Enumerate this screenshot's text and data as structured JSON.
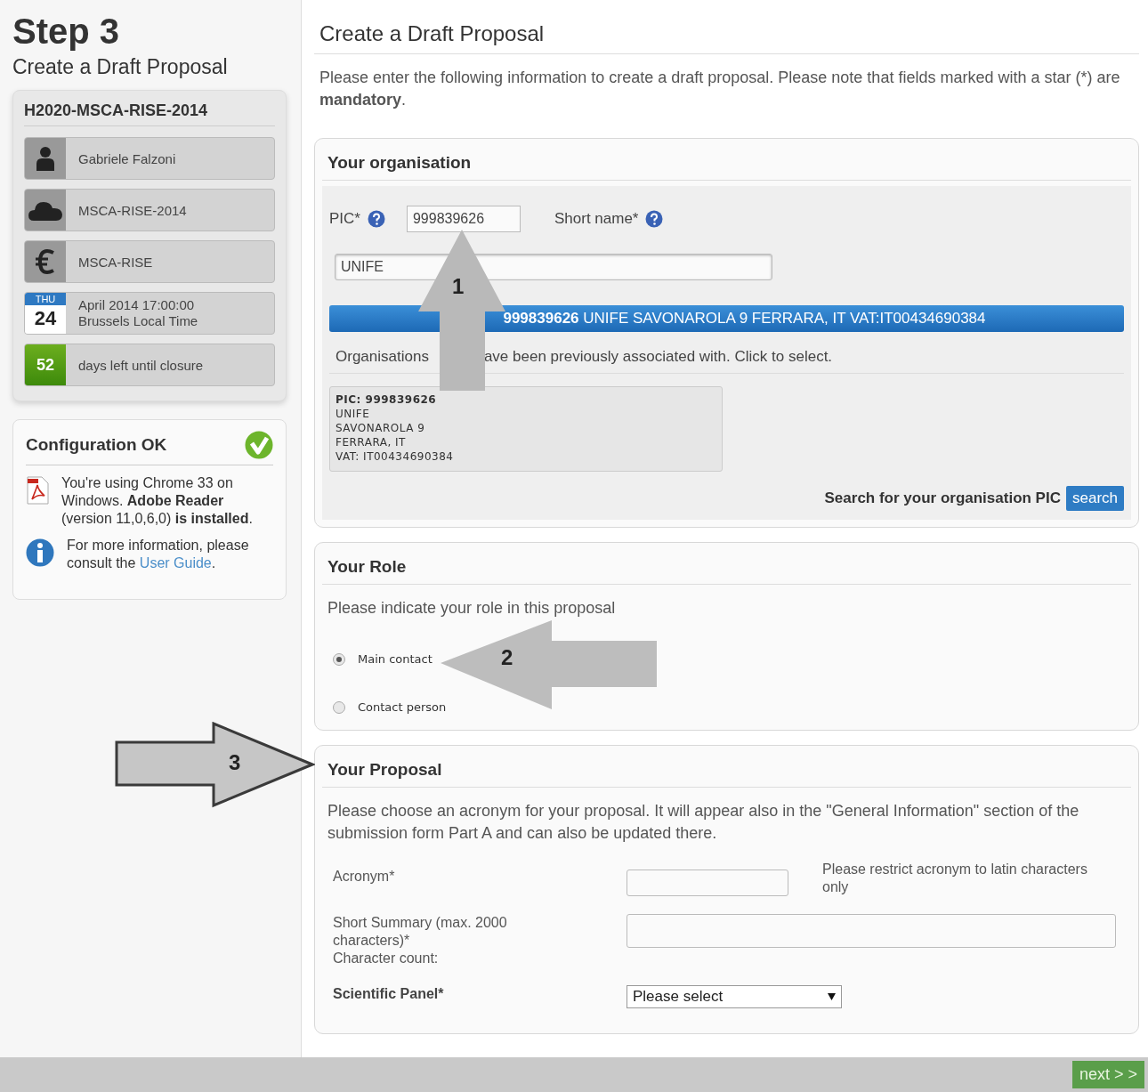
{
  "sidebar": {
    "step_title": "Step 3",
    "step_subtitle": "Create a Draft Proposal",
    "call": {
      "title": "H2020-MSCA-RISE-2014",
      "items": [
        {
          "kind": "person",
          "text": "Gabriele Falzoni"
        },
        {
          "kind": "cloud",
          "text": "MSCA-RISE-2014"
        },
        {
          "kind": "euro",
          "text": "MSCA-RISE"
        },
        {
          "kind": "date",
          "weekday": "THU",
          "day": "24",
          "lines": [
            "April 2014 17:00:00",
            "Brussels Local Time"
          ]
        },
        {
          "kind": "countdown",
          "number": "52",
          "text": "days left until closure"
        }
      ]
    },
    "config": {
      "title": "Configuration OK",
      "messages": [
        {
          "kind": "pdf",
          "text": "You're using Chrome 33 on Windows. **Adobe Reader** (version 11,0,6,0) **is installed**."
        },
        {
          "kind": "info",
          "text": "For more information, please consult the ",
          "link": "User Guide",
          "after": "."
        }
      ]
    }
  },
  "main": {
    "title": "Create a Draft Proposal",
    "intro": "Please enter the following information to create a draft proposal. Please note that fields marked with a star (*) are **mandatory**.",
    "organisation": {
      "title": "Your organisation",
      "pic_label": "PIC*",
      "pic_value": "999839626",
      "short_name_label": "Short name*",
      "short_name_value": "UNIFE",
      "suggestion": "**999839626** UNIFE SAVONAROLA 9 FERRARA, IT VAT:IT00434690384",
      "previous_note_parts": [
        "Organisations",
        "ave been previously associated with. Click to select."
      ],
      "previous": [
        {
          "lines": [
            "PIC: 999839626",
            "UNIFE",
            "SAVONAROLA 9",
            "FERRARA, IT",
            "VAT: IT00434690384"
          ]
        }
      ],
      "search_label": "Search for your organisation PIC",
      "search_button": "search"
    },
    "role": {
      "title": "Your Role",
      "prompt": "Please indicate your role in this proposal",
      "options": [
        {
          "label": "Main contact",
          "selected": true
        },
        {
          "label": "Contact person",
          "selected": false
        }
      ]
    },
    "proposal": {
      "title": "Your Proposal",
      "intro": "Please choose an acronym for your proposal. It will appear also in the \"General Information\" section of the submission form Part A and can also be updated there.",
      "fields": [
        {
          "kind": "text",
          "label": "Acronym*",
          "hint": "Please restrict acronym to latin characters only"
        },
        {
          "kind": "textarea",
          "label": "Short Summary (max. 2000 characters)*",
          "sublabel": "Character count:"
        },
        {
          "kind": "select",
          "label": "Scientific Panel*",
          "value": "Please select"
        }
      ]
    }
  },
  "arrows": [
    {
      "kind": "up",
      "number": "1"
    },
    {
      "kind": "left",
      "number": "2"
    },
    {
      "kind": "right",
      "number": "3"
    }
  ],
  "footer": {
    "next": "next > >"
  }
}
